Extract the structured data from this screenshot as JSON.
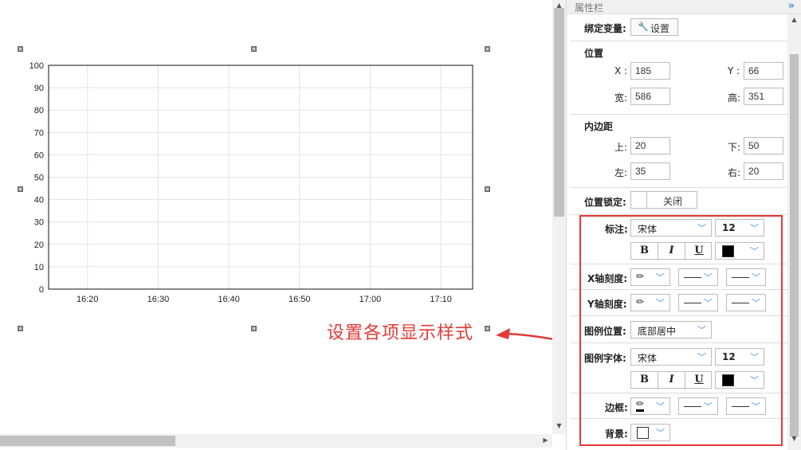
{
  "chart_data": {
    "type": "line",
    "series": [],
    "x_ticks": [
      "16:20",
      "16:30",
      "16:40",
      "16:50",
      "17:00",
      "17:10"
    ],
    "y_ticks": [
      0,
      10,
      20,
      30,
      40,
      50,
      60,
      70,
      80,
      90,
      100
    ],
    "ylim": [
      0,
      100
    ],
    "grid": true
  },
  "annotation": {
    "text": "设置各项显示样式"
  },
  "panel": {
    "title": "属性栏",
    "collapse_icon": "double-chevron-right-icon",
    "binding": {
      "label": "绑定变量:",
      "button": "设置",
      "icon": "wrench-icon"
    },
    "position": {
      "title": "位置",
      "x_label": "X :",
      "x_value": "185",
      "y_label": "Y :",
      "y_value": "66",
      "w_label": "宽:",
      "w_value": "586",
      "h_label": "高:",
      "h_value": "351"
    },
    "padding": {
      "title": "内边距",
      "top_label": "上:",
      "top_value": "20",
      "bottom_label": "下:",
      "bottom_value": "50",
      "left_label": "左:",
      "left_value": "35",
      "right_label": "右:",
      "right_value": "20"
    },
    "lock": {
      "label": "位置锁定:",
      "state": "关闭"
    },
    "label_font": {
      "label": "标注:",
      "font": "宋体",
      "size": "12",
      "bold": "B",
      "italic": "I",
      "underline": "U",
      "color": "#000000"
    },
    "x_axis": {
      "label": "X轴刻度:"
    },
    "y_axis": {
      "label": "Y轴刻度:"
    },
    "legend_position": {
      "label": "图例位置:",
      "value": "底部居中"
    },
    "legend_font": {
      "label": "图例字体:",
      "font": "宋体",
      "size": "12",
      "bold": "B",
      "italic": "I",
      "underline": "U",
      "color": "#000000"
    },
    "border": {
      "label": "边框:"
    },
    "background": {
      "label": "背景:",
      "color": "#ffffff"
    }
  },
  "colors": {
    "accent": "#4a8fd6",
    "highlight": "#e53935"
  }
}
